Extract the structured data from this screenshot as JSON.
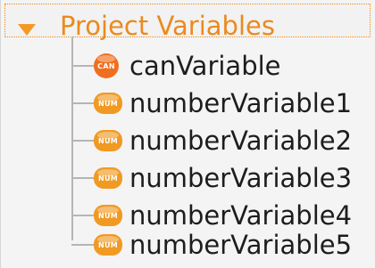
{
  "tree": {
    "header": {
      "label": "Project Variables",
      "expander_icon": "triangle-down-icon"
    },
    "items": [
      {
        "label": "canVariable",
        "badge": "CAN",
        "badge_type": "can"
      },
      {
        "label": "numberVariable1",
        "badge": "NUM",
        "badge_type": "num"
      },
      {
        "label": "numberVariable2",
        "badge": "NUM",
        "badge_type": "num"
      },
      {
        "label": "numberVariable3",
        "badge": "NUM",
        "badge_type": "num"
      },
      {
        "label": "numberVariable4",
        "badge": "NUM",
        "badge_type": "num"
      },
      {
        "label": "numberVariable5",
        "badge": "NUM",
        "badge_type": "num"
      }
    ]
  },
  "colors": {
    "accent": "#f39a26",
    "header_text": "#ea8a1e",
    "badge_num": "#f09a23",
    "badge_can": "#ef6f1f",
    "tree_line": "#b5b5b5",
    "text": "#1d1d1d",
    "background": "#f4f4f4"
  }
}
